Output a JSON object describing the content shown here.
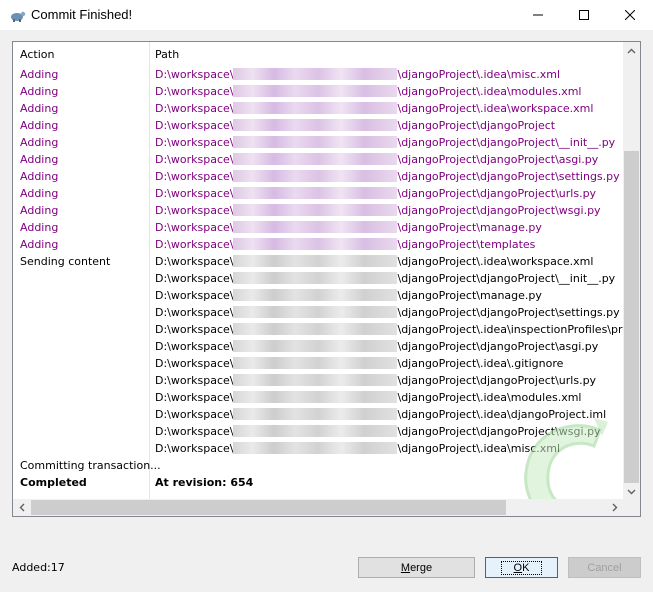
{
  "window": {
    "title": "Commit Finished!"
  },
  "columns": {
    "action": "Action",
    "path": "Path"
  },
  "rows": [
    {
      "action": "Adding",
      "prefix": "D:\\workspace\\",
      "suffix": "\\djangoProject\\.idea\\misc.xml",
      "type": "adding"
    },
    {
      "action": "Adding",
      "prefix": "D:\\workspace\\",
      "suffix": "\\djangoProject\\.idea\\modules.xml",
      "type": "adding"
    },
    {
      "action": "Adding",
      "prefix": "D:\\workspace\\",
      "suffix": "\\djangoProject\\.idea\\workspace.xml",
      "type": "adding"
    },
    {
      "action": "Adding",
      "prefix": "D:\\workspace\\",
      "suffix": "\\djangoProject\\djangoProject",
      "type": "adding"
    },
    {
      "action": "Adding",
      "prefix": "D:\\workspace\\",
      "suffix": "\\djangoProject\\djangoProject\\__init__.py",
      "type": "adding"
    },
    {
      "action": "Adding",
      "prefix": "D:\\workspace\\",
      "suffix": "\\djangoProject\\djangoProject\\asgi.py",
      "type": "adding"
    },
    {
      "action": "Adding",
      "prefix": "D:\\workspace\\",
      "suffix": "\\djangoProject\\djangoProject\\settings.py",
      "type": "adding"
    },
    {
      "action": "Adding",
      "prefix": "D:\\workspace\\",
      "suffix": "\\djangoProject\\djangoProject\\urls.py",
      "type": "adding"
    },
    {
      "action": "Adding",
      "prefix": "D:\\workspace\\",
      "suffix": "\\djangoProject\\djangoProject\\wsgi.py",
      "type": "adding"
    },
    {
      "action": "Adding",
      "prefix": "D:\\workspace\\",
      "suffix": "\\djangoProject\\manage.py",
      "type": "adding"
    },
    {
      "action": "Adding",
      "prefix": "D:\\workspace\\",
      "suffix": "\\djangoProject\\templates",
      "type": "adding"
    },
    {
      "action": "Sending content",
      "prefix": "D:\\workspace\\",
      "suffix": "\\djangoProject\\.idea\\workspace.xml",
      "type": "sending"
    },
    {
      "action": "",
      "prefix": "D:\\workspace\\",
      "suffix": "\\djangoProject\\djangoProject\\__init__.py",
      "type": "sending"
    },
    {
      "action": "",
      "prefix": "D:\\workspace\\",
      "suffix": "\\djangoProject\\manage.py",
      "type": "sending"
    },
    {
      "action": "",
      "prefix": "D:\\workspace\\",
      "suffix": "\\djangoProject\\djangoProject\\settings.py",
      "type": "sending"
    },
    {
      "action": "",
      "prefix": "D:\\workspace\\",
      "suffix": "\\djangoProject\\.idea\\inspectionProfiles\\profiles_se",
      "type": "sending"
    },
    {
      "action": "",
      "prefix": "D:\\workspace\\",
      "suffix": "\\djangoProject\\djangoProject\\asgi.py",
      "type": "sending"
    },
    {
      "action": "",
      "prefix": "D:\\workspace\\",
      "suffix": "\\djangoProject\\.idea\\.gitignore",
      "type": "sending"
    },
    {
      "action": "",
      "prefix": "D:\\workspace\\",
      "suffix": "\\djangoProject\\djangoProject\\urls.py",
      "type": "sending"
    },
    {
      "action": "",
      "prefix": "D:\\workspace\\",
      "suffix": "\\djangoProject\\.idea\\modules.xml",
      "type": "sending"
    },
    {
      "action": "",
      "prefix": "D:\\workspace\\",
      "suffix": "\\djangoProject\\.idea\\djangoProject.iml",
      "type": "sending"
    },
    {
      "action": "",
      "prefix": "D:\\workspace\\",
      "suffix": "\\djangoProject\\djangoProject\\wsgi.py",
      "type": "sending"
    },
    {
      "action": "",
      "prefix": "D:\\workspace\\",
      "suffix": "\\djangoProject\\.idea\\misc.xml",
      "type": "sending"
    },
    {
      "action": "Committing transaction...",
      "prefix": "",
      "suffix": "",
      "type": "sending"
    },
    {
      "action": "Completed",
      "prefix": "",
      "suffix": "At revision: 654",
      "type": "final"
    }
  ],
  "status": {
    "added": "Added:17"
  },
  "buttons": {
    "merge_pre": "",
    "merge_key": "M",
    "merge_post": "erge",
    "ok_key": "O",
    "ok_post": "K",
    "cancel": "Cancel"
  },
  "colors": {
    "adding": "#800080",
    "normal": "#000000",
    "accent": "#0078d7"
  },
  "icons": {
    "title": "tortoise-svn-icon",
    "minimize": "minimize-icon",
    "maximize": "maximize-icon",
    "close": "close-icon",
    "watermark": "tortoise-watermark-icon"
  }
}
